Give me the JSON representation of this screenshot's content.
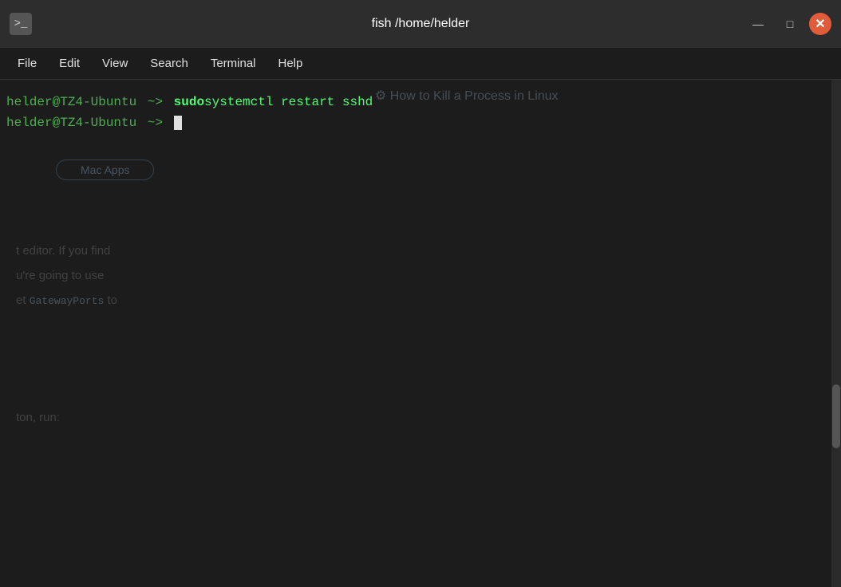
{
  "titleBar": {
    "title": "fish  /home/helder",
    "icon": ">_",
    "minimizeLabel": "—",
    "maximizeLabel": "□",
    "closeLabel": "✕"
  },
  "menuBar": {
    "items": [
      {
        "id": "file",
        "label": "File"
      },
      {
        "id": "edit",
        "label": "Edit"
      },
      {
        "id": "view",
        "label": "View"
      },
      {
        "id": "search",
        "label": "Search"
      },
      {
        "id": "terminal",
        "label": "Terminal"
      },
      {
        "id": "help",
        "label": "Help"
      }
    ]
  },
  "terminal": {
    "line1": {
      "prompt": "helder@TZ4-Ubuntu",
      "arrow": "~>",
      "command_bold": "sudo",
      "command_rest": " systemctl restart sshd"
    },
    "line2": {
      "prompt": "helder@TZ4-Ubuntu",
      "arrow": "~>"
    }
  },
  "bgContent": {
    "articleTitle": "⚙ How to Kill a Process in Linux",
    "macAppsLabel": "Mac Apps",
    "textLines": [
      "t editor. If you find",
      "u're going to use",
      "et GatewayPorts to",
      "",
      "",
      "ton, run:"
    ]
  }
}
